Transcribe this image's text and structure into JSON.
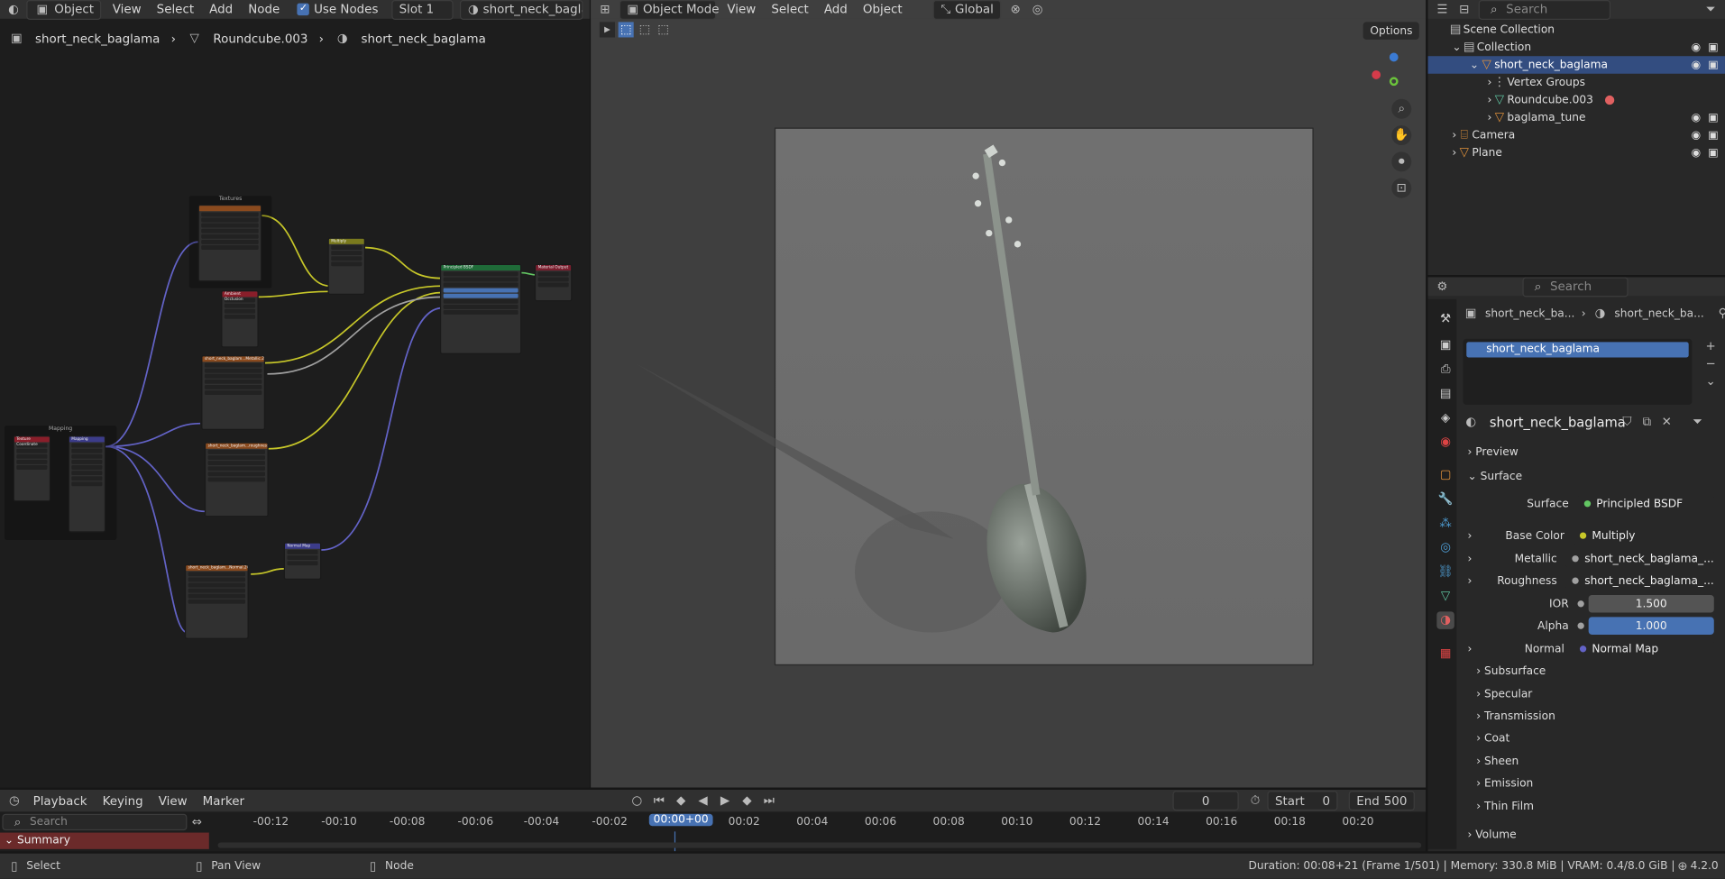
{
  "topbar": {
    "editor_mode": "Object",
    "menus": [
      "View",
      "Select",
      "Add",
      "Node"
    ],
    "use_nodes_label": "Use Nodes",
    "slot": "Slot 1",
    "material": "short_neck_baglama"
  },
  "node_editor": {
    "breadcrumb": [
      "short_neck_baglama",
      "Roundcube.003",
      "short_neck_baglama"
    ],
    "frames": {
      "textures": "Textures",
      "mapping": "Mapping"
    },
    "nodes": {
      "multiply": "Multiply",
      "principled": "Principled BSDF",
      "output": "Material Output",
      "ao": "Ambient Occlusion",
      "metallic_tex": "short_neck_baglam...Metallic.2001.png",
      "roughness_tex": "short_neck_baglam...roughness.2001.png",
      "normal_tex": "short_neck_baglam...Normal.2001.png",
      "normal_map": "Normal Map",
      "tex_coord": "Texture Coordinate",
      "mapping": "Mapping"
    }
  },
  "viewport": {
    "mode": "Object Mode",
    "menus": [
      "View",
      "Select",
      "Add",
      "Object"
    ],
    "orientation": "Global",
    "options_label": "Options"
  },
  "outliner": {
    "search_placeholder": "Search",
    "items": [
      {
        "label": "Scene Collection"
      },
      {
        "label": "Collection"
      },
      {
        "label": "short_neck_baglama"
      },
      {
        "label": "Vertex Groups"
      },
      {
        "label": "Roundcube.003"
      },
      {
        "label": "baglama_tune"
      },
      {
        "label": "Camera"
      },
      {
        "label": "Plane"
      }
    ]
  },
  "properties": {
    "search_placeholder": "Search",
    "breadcrumb": [
      "short_neck_ba...",
      "short_neck_ba..."
    ],
    "slot_name": "short_neck_baglama",
    "material_name": "short_neck_baglama",
    "sections": {
      "preview": "Preview",
      "surface": "Surface"
    },
    "fields": [
      {
        "label": "Surface",
        "value": "Principled BSDF",
        "color": "#63c763"
      },
      {
        "label": "Base Color",
        "value": "Multiply",
        "color": "#c7c729"
      },
      {
        "label": "Metallic",
        "value": "short_neck_baglama_...",
        "color": "#a1a1a1"
      },
      {
        "label": "Roughness",
        "value": "short_neck_baglama_...",
        "color": "#a1a1a1"
      },
      {
        "label": "IOR",
        "value": "1.500",
        "color": "#a1a1a1"
      },
      {
        "label": "Alpha",
        "value": "1.000",
        "color": "#a1a1a1"
      },
      {
        "label": "Normal",
        "value": "Normal Map",
        "color": "#6363c7"
      }
    ],
    "subsections": [
      "Subsurface",
      "Specular",
      "Transmission",
      "Coat",
      "Sheen",
      "Emission",
      "Thin Film"
    ],
    "volume": "Volume"
  },
  "timeline": {
    "menus": [
      "Playback",
      "Keying",
      "View",
      "Marker"
    ],
    "current_frame": "0",
    "start_label": "Start",
    "start": "0",
    "end_label": "End",
    "end": "500",
    "current_time": "00:00+00",
    "search_placeholder": "Search",
    "summary": "Summary",
    "ticks": [
      "-00:12",
      "-00:10",
      "-00:08",
      "-00:06",
      "-00:04",
      "-00:02",
      "00:02",
      "00:04",
      "00:06",
      "00:08",
      "00:10",
      "00:12",
      "00:14",
      "00:16",
      "00:18",
      "00:20"
    ]
  },
  "statusbar": {
    "select": "Select",
    "pan_view": "Pan View",
    "node": "Node",
    "stats": "Duration: 00:08+21 (Frame 1/501) | Memory: 330.8 MiB | VRAM: 0.4/8.0 GiB |",
    "version": "4.2.0"
  },
  "colors": {
    "accent": "#4772b3",
    "selected_row": "#334d80",
    "summary": "#6b2a2a"
  }
}
